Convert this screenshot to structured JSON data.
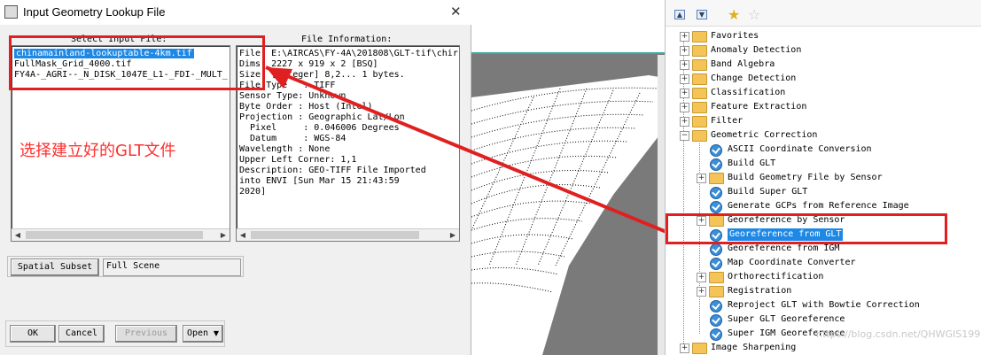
{
  "dialog": {
    "title": "Input Geometry Lookup File",
    "select_label": "Select Input File:",
    "files": [
      "chinamainland-lookuptable-4km.tif",
      "FullMask_Grid_4000.tif",
      "FY4A-_AGRI--_N_DISK_1047E_L1-_FDI-_MULT_"
    ],
    "info_label": "File Information:",
    "info_lines": [
      "File: E:\\AIRCAS\\FY-4A\\201808\\GLT-tif\\chir",
      "Dims: 2227 x 919 x 2 [BSQ]",
      "Size: [Integer] 8,2... 1 bytes.",
      "File Type   : TIFF",
      "Sensor Type: Unknown",
      "Byte Order : Host (Intel)",
      "Projection : Geographic Lat/Lon",
      "  Pixel     : 0.046006 Degrees",
      "  Datum     : WGS-84",
      "Wavelength : None",
      "Upper Left Corner: 1,1",
      "Description: GEO-TIFF File Imported",
      "into ENVI [Sun Mar 15 21:43:59",
      "2020]"
    ],
    "annotation": "选择建立好的GLT文件",
    "spatial_subset_label": "Spatial Subset",
    "spatial_subset_value": "Full Scene",
    "buttons": {
      "ok": "OK",
      "cancel": "Cancel",
      "previous": "Previous",
      "open": "Open"
    }
  },
  "toolbox": {
    "items": [
      {
        "label": "Favorites",
        "kind": "folder",
        "level": 0
      },
      {
        "label": "Anomaly Detection",
        "kind": "folder",
        "level": 0
      },
      {
        "label": "Band Algebra",
        "kind": "folder",
        "level": 0
      },
      {
        "label": "Change Detection",
        "kind": "folder",
        "level": 0
      },
      {
        "label": "Classification",
        "kind": "folder",
        "level": 0
      },
      {
        "label": "Feature Extraction",
        "kind": "folder",
        "level": 0
      },
      {
        "label": "Filter",
        "kind": "folder",
        "level": 0
      },
      {
        "label": "Geometric Correction",
        "kind": "folder-open",
        "level": 0
      },
      {
        "label": "ASCII Coordinate Conversion",
        "kind": "tool",
        "level": 1
      },
      {
        "label": "Build GLT",
        "kind": "tool",
        "level": 1
      },
      {
        "label": "Build Geometry File by Sensor",
        "kind": "folder",
        "level": 1
      },
      {
        "label": "Build Super GLT",
        "kind": "tool",
        "level": 1
      },
      {
        "label": "Generate GCPs from Reference Image",
        "kind": "tool",
        "level": 1
      },
      {
        "label": "Georeference by Sensor",
        "kind": "folder",
        "level": 1
      },
      {
        "label": "Georeference from GLT",
        "kind": "tool-selected",
        "level": 1
      },
      {
        "label": "Georeference from IGM",
        "kind": "tool",
        "level": 1
      },
      {
        "label": "Map Coordinate Converter",
        "kind": "tool",
        "level": 1
      },
      {
        "label": "Orthorectification",
        "kind": "folder",
        "level": 1
      },
      {
        "label": "Registration",
        "kind": "folder",
        "level": 1
      },
      {
        "label": "Reproject GLT with Bowtie Correction",
        "kind": "tool",
        "level": 1
      },
      {
        "label": "Super GLT Georeference",
        "kind": "tool",
        "level": 1
      },
      {
        "label": "Super IGM Georeference",
        "kind": "tool",
        "level": 1
      },
      {
        "label": "Image Sharpening",
        "kind": "folder",
        "level": 0
      }
    ],
    "watermark": "https://blog.csdn.net/QHWGIS1999"
  },
  "colors": {
    "selection": "#1e88e5",
    "annotation_red": "#e02020",
    "viewer_gray": "#7a7a7a",
    "viewer_teal": "#3aa9a0"
  }
}
